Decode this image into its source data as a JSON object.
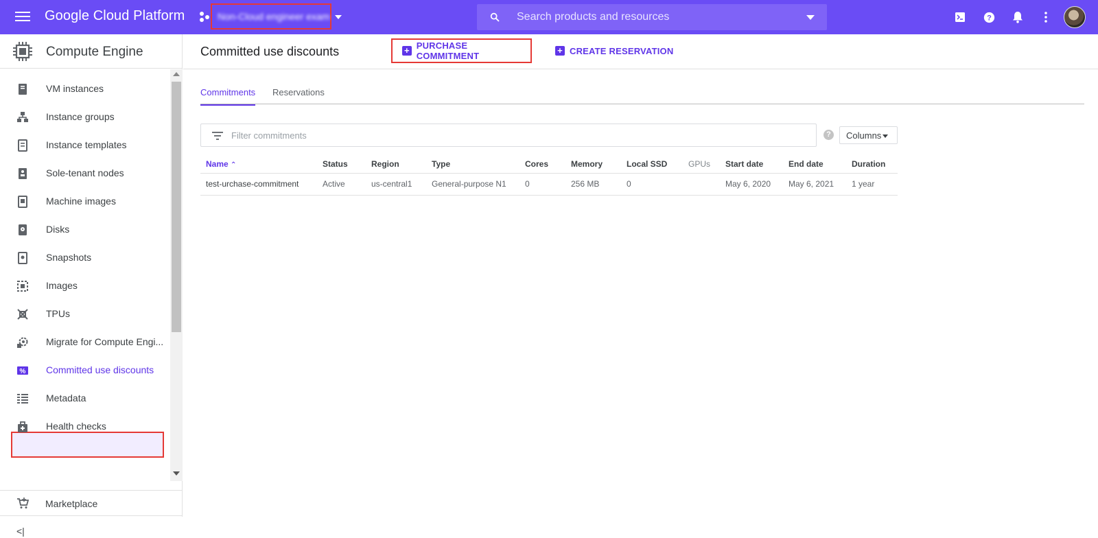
{
  "topbar": {
    "brand": "Google Cloud Platform",
    "project_name": "Non-Cloud engineer exam",
    "search_placeholder": "Search products and resources"
  },
  "sidebar": {
    "title": "Compute Engine",
    "items": [
      {
        "label": "VM instances",
        "icon": "vm-instances-icon"
      },
      {
        "label": "Instance groups",
        "icon": "instance-groups-icon"
      },
      {
        "label": "Instance templates",
        "icon": "instance-templates-icon"
      },
      {
        "label": "Sole-tenant nodes",
        "icon": "sole-tenant-icon"
      },
      {
        "label": "Machine images",
        "icon": "machine-images-icon"
      },
      {
        "label": "Disks",
        "icon": "disk-icon"
      },
      {
        "label": "Snapshots",
        "icon": "snapshot-icon"
      },
      {
        "label": "Images",
        "icon": "images-icon"
      },
      {
        "label": "TPUs",
        "icon": "tpu-icon"
      },
      {
        "label": "Migrate for Compute Engi...",
        "icon": "migrate-icon"
      },
      {
        "label": "Committed use discounts",
        "icon": "percent-icon",
        "active": true
      },
      {
        "label": "Metadata",
        "icon": "metadata-icon"
      },
      {
        "label": "Health checks",
        "icon": "health-check-icon"
      }
    ],
    "marketplace": "Marketplace",
    "collapse_label": "<|"
  },
  "main": {
    "title": "Committed use discounts",
    "purchase_label": "PURCHASE COMMITMENT",
    "reservation_label": "CREATE RESERVATION",
    "tabs": [
      "Commitments",
      "Reservations"
    ],
    "filter_placeholder": "Filter commitments",
    "columns_label": "Columns",
    "table": {
      "headers": [
        "Name",
        "Status",
        "Region",
        "Type",
        "Cores",
        "Memory",
        "Local SSD",
        "GPUs",
        "Start date",
        "End date",
        "Duration"
      ],
      "rows": [
        [
          "test-urchase-commitment",
          "Active",
          "us-central1",
          "General-purpose N1",
          "0",
          "256 MB",
          "0",
          "",
          "May 6, 2020",
          "May 6, 2021",
          "1 year"
        ]
      ]
    }
  },
  "colors": {
    "topbar": "#6a4cf5",
    "accent": "#5f35e8",
    "highlight_border": "#e53935"
  }
}
